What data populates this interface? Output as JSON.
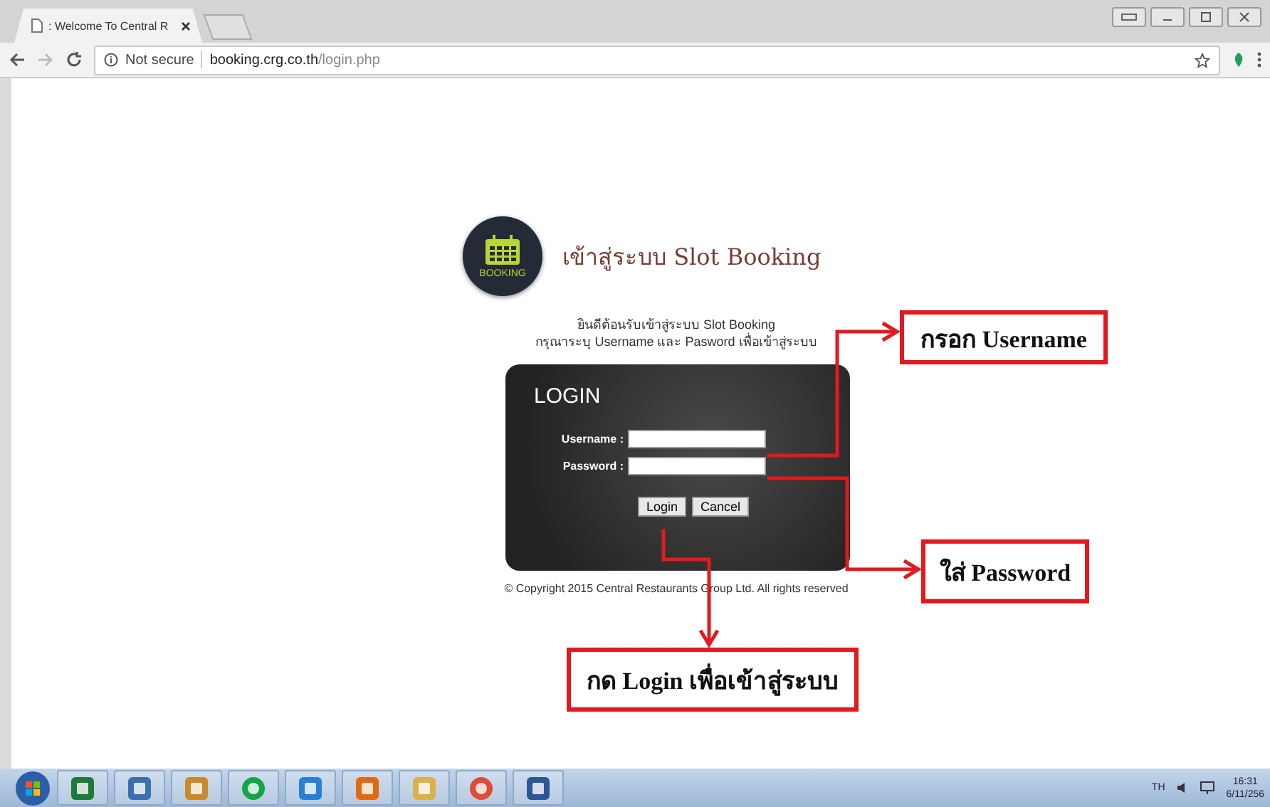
{
  "browser": {
    "tab_title": ": Welcome To Central R",
    "address": {
      "security": "Not secure",
      "host": "booking.crg.co.th",
      "path": "/login.php"
    }
  },
  "page": {
    "logo_label": "BOOKING",
    "heading": "เข้าสู่ระบบ Slot Booking",
    "welcome_lines": [
      "ยินดีต้อนรับเข้าสู่ระบบ Slot Booking",
      "กรุณาระบุ Username และ Pasword เพื่อเข้าสู่ระบบ"
    ],
    "login_panel": {
      "title": "LOGIN",
      "fields": [
        {
          "label": "Username :"
        },
        {
          "label": "Password :"
        }
      ],
      "buttons": [
        "Login",
        "Cancel"
      ]
    },
    "copyright": "© Copyright 2015 Central Restaurants Group Ltd. All rights reserved"
  },
  "callouts": [
    {
      "text": "กรอก Username"
    },
    {
      "text": "ใส่ Password"
    },
    {
      "text": "กด Login เพื่อเข้าสู่ระบบ"
    }
  ],
  "taskbar": {
    "language": "TH",
    "time": "16:31",
    "date": "6/11/256"
  }
}
